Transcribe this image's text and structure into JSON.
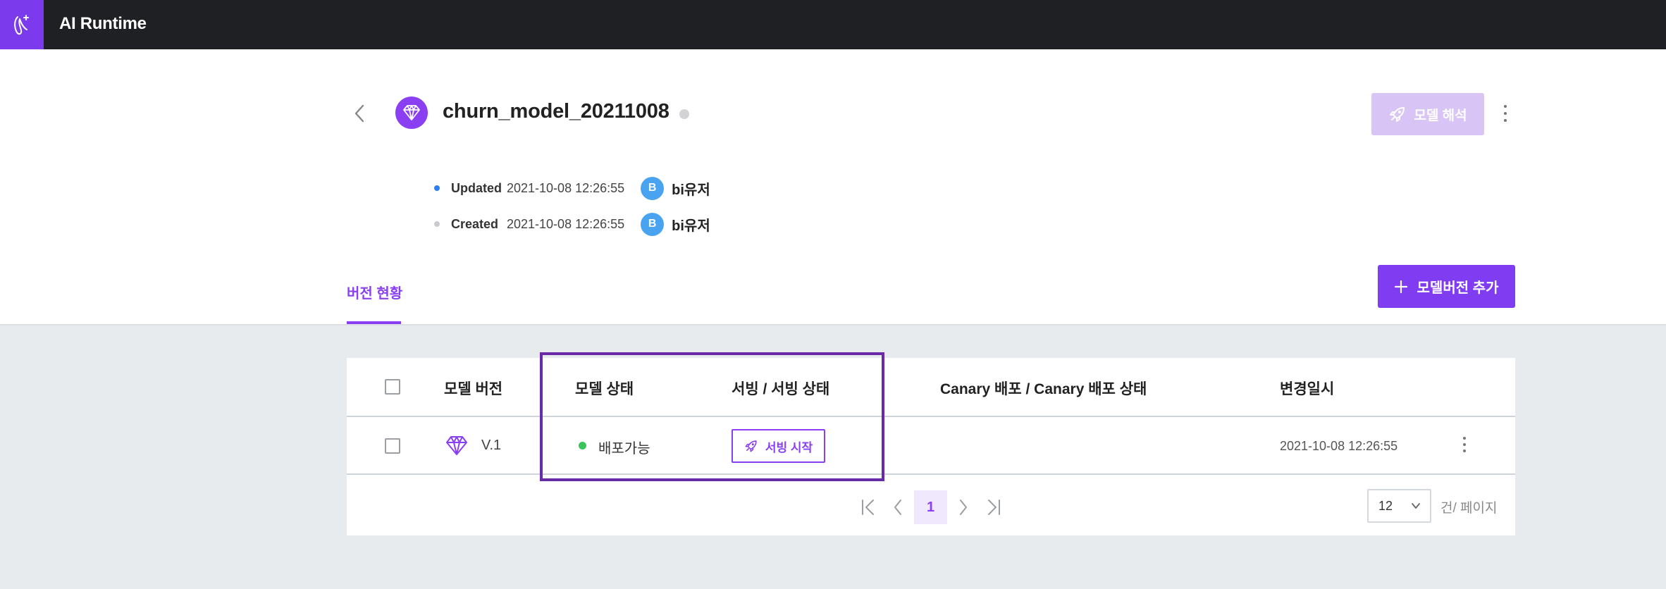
{
  "app": {
    "title": "AI Runtime"
  },
  "model": {
    "name": "churn_model_20211008",
    "interpret_label": "모델 해석",
    "updated": {
      "label": "Updated",
      "date": "2021-10-08 12:26:55",
      "avatar": "B",
      "user": "bi유저",
      "dot_color": "#2d7ef0"
    },
    "created": {
      "label": "Created",
      "date": "2021-10-08 12:26:55",
      "avatar": "B",
      "user": "bi유저",
      "dot_color": "#c9cbcf"
    }
  },
  "tabs": [
    {
      "label": "버전 현황",
      "active": true
    }
  ],
  "add_version_label": "모델버전 추가",
  "table": {
    "headers": {
      "version": "모델 버전",
      "state": "모델 상태",
      "serving": "서빙 / 서빙 상태",
      "canary": "Canary 배포 / Canary 배포 상태",
      "modified": "변경일시"
    },
    "rows": [
      {
        "version": "V.1",
        "state": "배포가능",
        "serving_action": "서빙 시작",
        "canary": "",
        "modified": "2021-10-08 12:26:55"
      }
    ]
  },
  "pagination": {
    "current_page": "1",
    "page_size": "12",
    "page_size_label": "건/ 페이지"
  },
  "colors": {
    "accent": "#8a3ff2",
    "topbar": "#1f2023",
    "status_ok": "#3ac45a",
    "highlight_box": "#6a2aa8"
  },
  "icons": {
    "logo": "runtime-logo-icon",
    "back": "chevron-left-icon",
    "model": "diamond-icon",
    "interpret": "rocket-icon",
    "more": "more-vertical-icon",
    "add": "plus-icon",
    "serve": "rocket-icon",
    "first": "first-page-icon",
    "prev": "chevron-left-icon",
    "next": "chevron-right-icon",
    "last": "last-page-icon",
    "dropdown": "chevron-down-icon"
  }
}
